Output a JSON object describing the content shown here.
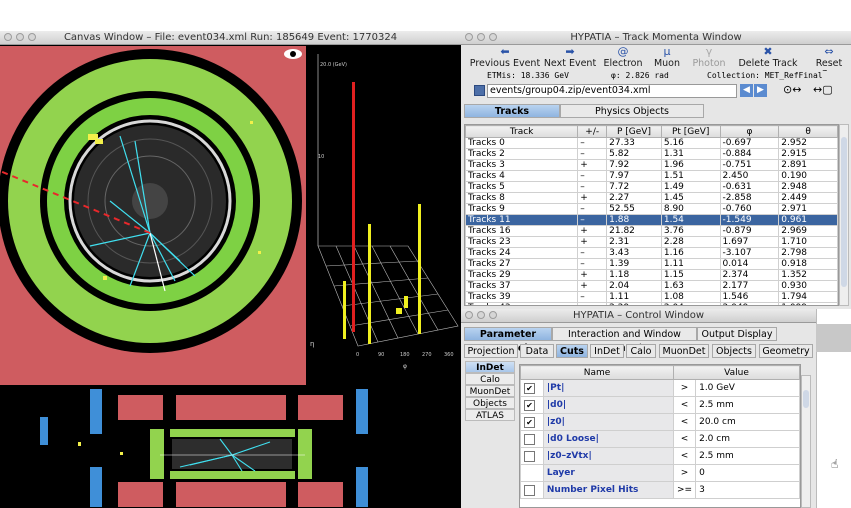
{
  "canvas_window": {
    "title": "Canvas Window –  File: event034.xml  Run: 185649  Event: 1770324",
    "lego_axis": {
      "y_top": "20.0 (GeV)",
      "y_mid": "10",
      "eta_label": "η",
      "phi_label": "φ",
      "phi_ticks": [
        "0",
        "90",
        "180",
        "270",
        "360"
      ]
    }
  },
  "track_window": {
    "title": "HYPATIA – Track Momenta Window",
    "toolbar": [
      {
        "label": "Previous Event",
        "icon": "arrow-left-icon",
        "glyph": "⬅",
        "enabled": true
      },
      {
        "label": "Next Event",
        "icon": "arrow-right-icon",
        "glyph": "➡",
        "enabled": true
      },
      {
        "label": "Electron",
        "icon": "electron-icon",
        "glyph": "@",
        "enabled": true
      },
      {
        "label": "Muon",
        "icon": "muon-icon",
        "glyph": "μ",
        "enabled": true
      },
      {
        "label": "Photon",
        "icon": "photon-icon",
        "glyph": "γ",
        "enabled": false
      },
      {
        "label": "Delete Track",
        "icon": "delete-icon",
        "glyph": "✖",
        "enabled": true
      },
      {
        "label": "Reset Car",
        "icon": "reset-icon",
        "glyph": "⇔",
        "enabled": true
      }
    ],
    "info": {
      "etmis": "ETMis: 18.336 GeV",
      "phi": "φ: 2.826 rad",
      "collection": "Collection: MET_RefFinal"
    },
    "path": "events/group04.zip/event034.xml",
    "tabs": [
      {
        "label": "Tracks",
        "selected": true
      },
      {
        "label": "Physics Objects",
        "selected": false
      }
    ],
    "columns": [
      "Track",
      "+/-",
      "P [GeV]",
      "Pt [GeV]",
      "φ",
      "θ"
    ],
    "rows": [
      [
        "Tracks 0",
        "–",
        "27.33",
        "5.16",
        "-0.697",
        "2.952"
      ],
      [
        "Tracks 2",
        "–",
        "5.82",
        "1.31",
        "-0.884",
        "2.915"
      ],
      [
        "Tracks 3",
        "+",
        "7.92",
        "1.96",
        "-0.751",
        "2.891"
      ],
      [
        "Tracks 4",
        "–",
        "7.97",
        "1.51",
        "2.450",
        "0.190"
      ],
      [
        "Tracks 5",
        "–",
        "7.72",
        "1.49",
        "-0.631",
        "2.948"
      ],
      [
        "Tracks 8",
        "+",
        "2.27",
        "1.45",
        "-2.858",
        "2.449"
      ],
      [
        "Tracks 9",
        "–",
        "52.55",
        "8.90",
        "-0.760",
        "2.971"
      ],
      [
        "Tracks 11",
        "–",
        "1.88",
        "1.54",
        "-1.549",
        "0.961"
      ],
      [
        "Tracks 16",
        "+",
        "21.82",
        "3.76",
        "-0.879",
        "2.969"
      ],
      [
        "Tracks 23",
        "+",
        "2.31",
        "2.28",
        "1.697",
        "1.710"
      ],
      [
        "Tracks 24",
        "–",
        "3.43",
        "1.16",
        "-3.107",
        "2.798"
      ],
      [
        "Tracks 27",
        "–",
        "1.39",
        "1.11",
        "0.014",
        "0.918"
      ],
      [
        "Tracks 29",
        "+",
        "1.18",
        "1.15",
        "2.374",
        "1.352"
      ],
      [
        "Tracks 37",
        "+",
        "2.04",
        "1.63",
        "2.177",
        "0.930"
      ],
      [
        "Tracks 39",
        "–",
        "1.11",
        "1.08",
        "1.546",
        "1.794"
      ],
      [
        "Tracks 43",
        "–",
        "2.29",
        "2.04",
        "2.049",
        "1.099"
      ]
    ],
    "selected_row": 7
  },
  "control_window": {
    "title": "HYPATIA – Control Window",
    "main_tabs": [
      {
        "label": "Parameter Control",
        "selected": true
      },
      {
        "label": "Interaction and Window Control",
        "selected": false
      },
      {
        "label": "Output Display",
        "selected": false
      }
    ],
    "sub_tabs": [
      {
        "label": "Projection",
        "selected": false
      },
      {
        "label": "Data",
        "selected": false
      },
      {
        "label": "Cuts",
        "selected": true
      },
      {
        "label": "InDet",
        "selected": false
      },
      {
        "label": "Calo",
        "selected": false
      },
      {
        "label": "MuonDet",
        "selected": false
      },
      {
        "label": "Objects",
        "selected": false
      },
      {
        "label": "Geometry",
        "selected": false
      }
    ],
    "side_tabs": [
      {
        "label": "InDet",
        "selected": true
      },
      {
        "label": "Calo",
        "selected": false
      },
      {
        "label": "MuonDet",
        "selected": false
      },
      {
        "label": "Objects",
        "selected": false
      },
      {
        "label": "ATLAS",
        "selected": false
      }
    ],
    "columns": [
      "Name",
      "Value"
    ],
    "cuts": [
      {
        "name": "|Pt|",
        "checked": true,
        "op": ">",
        "value": "1.0 GeV"
      },
      {
        "name": "|d0|",
        "checked": true,
        "op": "<",
        "value": "2.5 mm"
      },
      {
        "name": "|z0|",
        "checked": true,
        "op": "<",
        "value": "20.0 cm"
      },
      {
        "name": "|d0 Loose|",
        "checked": false,
        "op": "<",
        "value": "2.0 cm"
      },
      {
        "name": "|z0–zVtx|",
        "checked": false,
        "op": "<",
        "value": "2.5 mm"
      },
      {
        "name": "Layer",
        "checked": null,
        "op": ">",
        "value": "0"
      },
      {
        "name": "Number Pixel Hits",
        "checked": false,
        "op": ">=",
        "value": "3"
      }
    ]
  }
}
